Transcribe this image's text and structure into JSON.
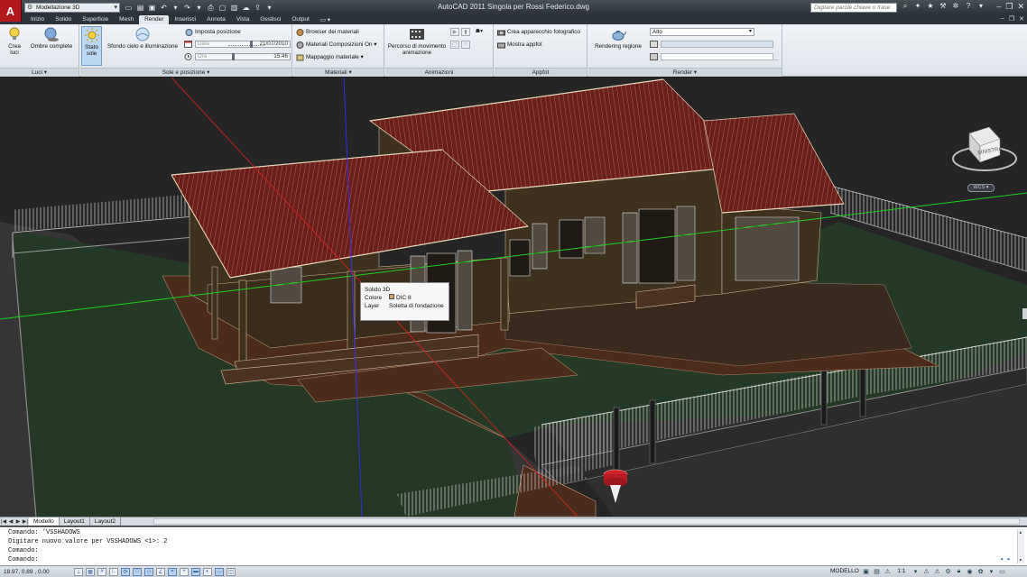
{
  "titlebar": {
    "app_logo": "A",
    "workspace": "Modellazione 3D",
    "title": "AutoCAD 2011    Singola per Rossi Federico.dwg",
    "search_placeholder": "Digitare parole chiave o frase",
    "qat_icons": [
      "new-icon",
      "open-icon",
      "save-icon",
      "undo-icon",
      "redo-icon",
      "plot-icon",
      "window-icon",
      "save-as-icon",
      "cloud-icon",
      "dropdown-icon"
    ]
  },
  "tabs": [
    "Inizio",
    "Solido",
    "Superficie",
    "Mesh",
    "Render",
    "Inserisci",
    "Annota",
    "Vista",
    "Gestisci",
    "Output"
  ],
  "active_tab": "Render",
  "ribbon": {
    "luci": {
      "title": "Luci",
      "crea_luci": "Crea luci",
      "ombre": "Ombre complete"
    },
    "sole": {
      "title": "Sole e posizione",
      "stato_sole": "Stato sole",
      "sfondo": "Sfondo cielo e illuminazione",
      "imposta": "Imposta posizione",
      "data_label": "Data",
      "data_value": "21/07/2010",
      "ora_label": "Ora",
      "ora_value": "15.46"
    },
    "materiali": {
      "title": "Materiali",
      "browser": "Browser dei materiali",
      "composizioni": "Materiali Composizioni On",
      "mappaggio": "Mappaggio materiale"
    },
    "animazioni": {
      "title": "Animazioni",
      "percorso": "Percorso di movimento animazione"
    },
    "appfot": {
      "title": "Appfot",
      "crea": "Crea apparecchio fotografico",
      "mostra": "Mostra appfot"
    },
    "render": {
      "title": "Render",
      "rendering": "Rendering regione",
      "quality": "Alto"
    }
  },
  "viewport": {
    "tooltip": {
      "title": "Solido 3D",
      "colore_label": "Colore",
      "colore_value": "DIC 8",
      "layer_label": "Layer",
      "layer_value": "Soletta di fondazione"
    },
    "viewcube_label": "SINISTRA",
    "wcs_label": "WCS"
  },
  "layout_tabs": [
    "Modello",
    "Layout1",
    "Layout2"
  ],
  "command": {
    "lines": [
      "Comando: 'VSSHADOWS",
      "Digitare nuovo valore per VSSHADOWS <1>: 2",
      "Comando:"
    ],
    "prompt": "Comando:"
  },
  "status": {
    "coords": "18.97, 0.89 , 0.00",
    "model": "MODELLO",
    "scale": "1:1"
  },
  "colors": {
    "roof": "#6b1f1a",
    "lawn": "#253a26",
    "wall": "#3f3120",
    "paving": "#4a2b1c",
    "pin": "#d0222a"
  }
}
